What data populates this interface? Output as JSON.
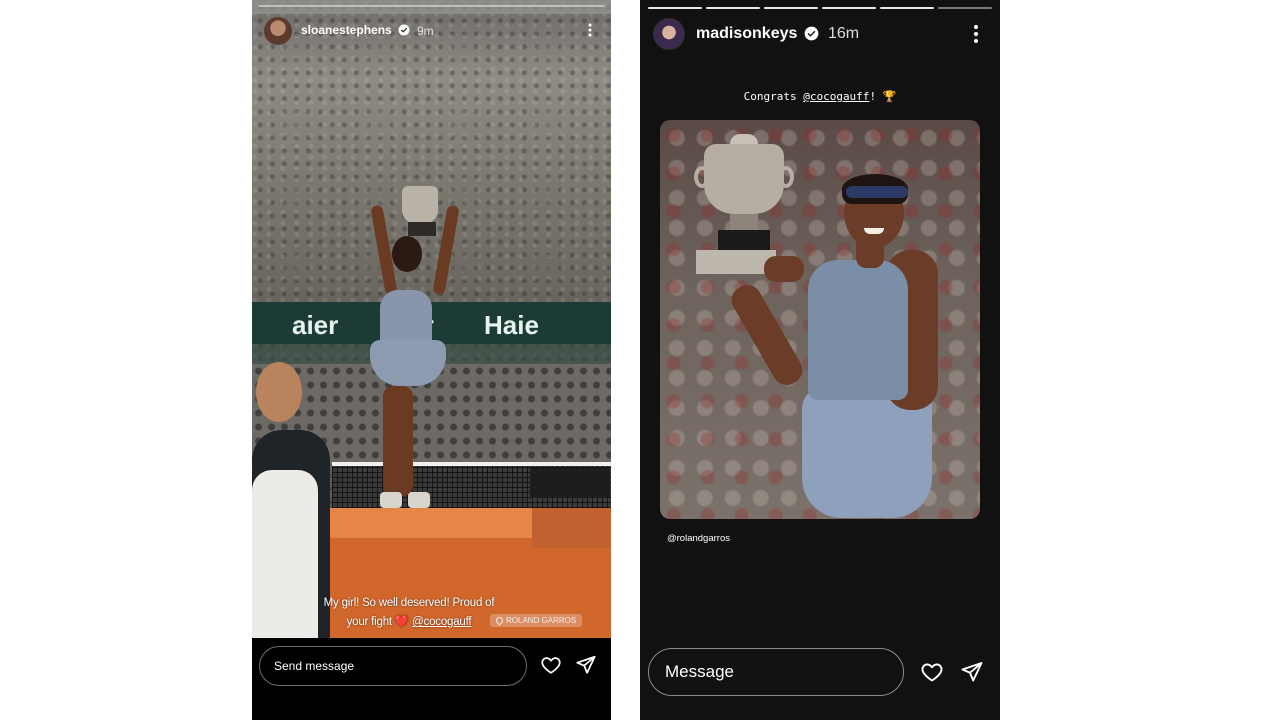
{
  "left_story": {
    "username": "sloanestephens",
    "time": "9m",
    "caption_line1": "My girl! So well deserved! Proud of",
    "caption_line2_prefix": "your fight",
    "caption_heart": "❤️",
    "caption_mention": "@cocogauff",
    "location_sticker": "ROLAND GARROS",
    "banner_text": [
      "aier",
      "ier",
      "Haie"
    ],
    "reply_placeholder": "Send message",
    "icons": [
      "verified-badge-icon",
      "more-options-icon",
      "heart-icon",
      "send-icon",
      "location-pin-icon"
    ]
  },
  "right_story": {
    "username": "madisonkeys",
    "time": "16m",
    "caption_prefix": "Congrats ",
    "caption_mention": "@cocogauff",
    "caption_suffix": "! ",
    "caption_emoji": "🏆",
    "photo_credit": "@rolandgarros",
    "reply_placeholder": "Message",
    "progress_segments": 6,
    "icons": [
      "verified-badge-icon",
      "more-options-icon",
      "heart-icon",
      "send-icon"
    ]
  },
  "colors": {
    "verified": "#3897f0",
    "heart_red": "#e0233a",
    "clay_orange": "#d2672b",
    "banner_green": "#1c3b36"
  }
}
